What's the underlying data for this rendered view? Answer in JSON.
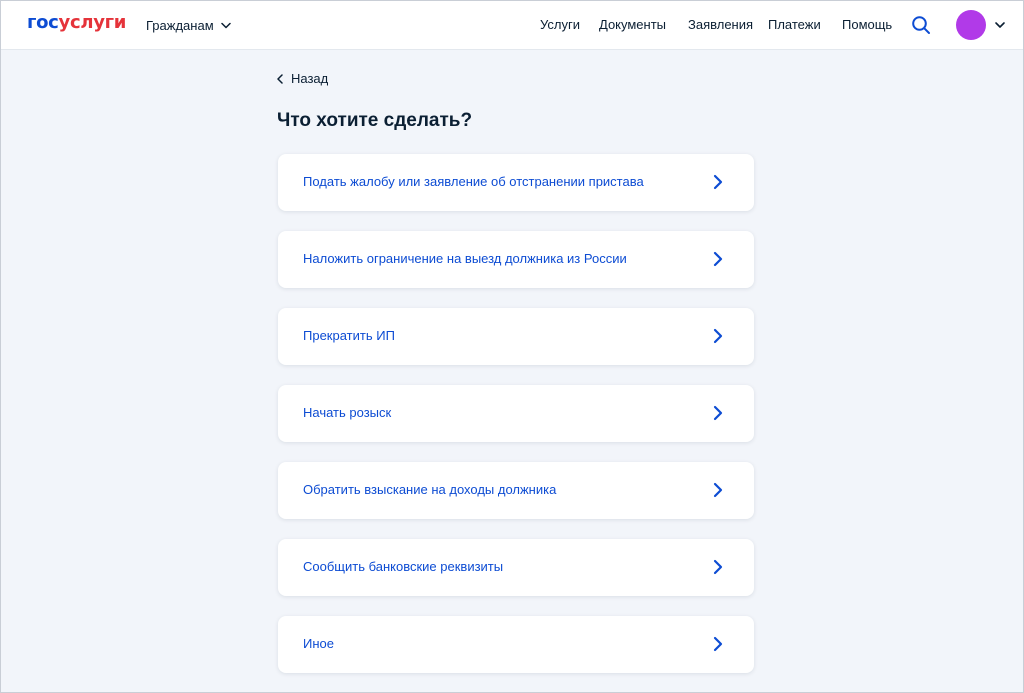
{
  "header": {
    "logo": {
      "part1": "гос",
      "part2": "услуги"
    },
    "audience": "Гражданам",
    "nav": [
      "Услуги",
      "Документы",
      "Заявления",
      "Платежи",
      "Помощь"
    ],
    "icons": {
      "search": "search-icon",
      "avatar": "avatar",
      "dropdown": "chevron-down-icon"
    }
  },
  "main": {
    "back_label": "Назад",
    "title": "Что хотите сделать?",
    "options": [
      {
        "label": "Подать жалобу или заявление об отстранении пристава"
      },
      {
        "label": "Наложить ограничение на выезд должника из России"
      },
      {
        "label": "Прекратить ИП"
      },
      {
        "label": "Начать розыск"
      },
      {
        "label": "Обратить взыскание на доходы должника"
      },
      {
        "label": "Сообщить банковские реквизиты"
      },
      {
        "label": "Иное"
      }
    ]
  },
  "colors": {
    "brand_blue": "#0d4cd3",
    "brand_red": "#e5333a",
    "text": "#0b1f33",
    "background": "#f2f5fa",
    "avatar": "#b13ae8"
  }
}
